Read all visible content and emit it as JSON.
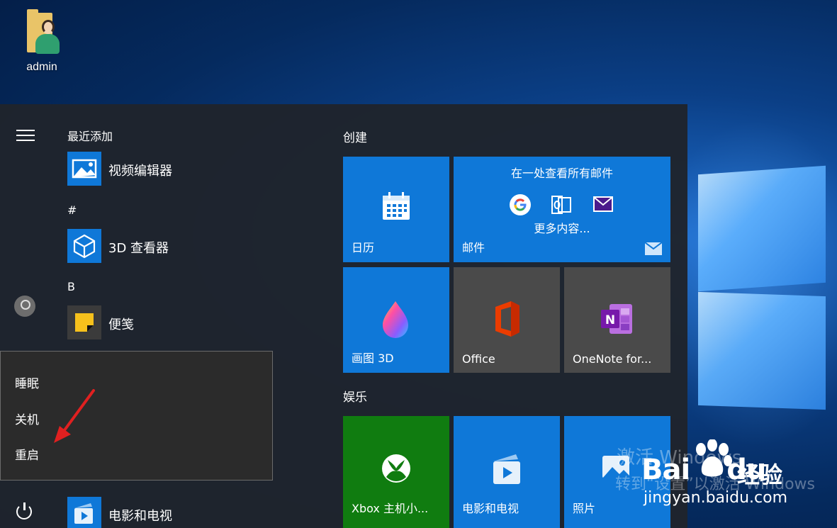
{
  "desktop": {
    "icon_label": "admin"
  },
  "start_menu": {
    "app_list": {
      "recent_header": "最近添加",
      "hash_header": "#",
      "b_header": "B",
      "apps": [
        {
          "name": "视频编辑器",
          "icon": "video-editor-icon"
        },
        {
          "name": "3D 查看器",
          "icon": "3d-viewer-icon"
        },
        {
          "name": "便笺",
          "icon": "sticky-notes-icon"
        },
        {
          "name": "电影和电视",
          "icon": "movies-tv-icon"
        }
      ]
    },
    "tiles": {
      "create_header": "创建",
      "entertainment_header": "娱乐",
      "calendar": "日历",
      "mail": "邮件",
      "mail_promo": "在一处查看所有邮件",
      "mail_more": "更多内容...",
      "paint3d": "画图 3D",
      "office": "Office",
      "onenote": "OneNote for...",
      "xbox": "Xbox 主机小...",
      "movies": "电影和电视",
      "photos": "照片"
    },
    "power_menu": {
      "sleep": "睡眠",
      "shutdown": "关机",
      "restart": "重启"
    }
  },
  "watermark": {
    "activate": "激活 Windows",
    "goto": "转到“设置”以激活 Windows",
    "brand_a": "Bai",
    "brand_b": "du",
    "brand_cn": "经验",
    "url": "jingyan.baidu.com"
  },
  "colors": {
    "tile_blue": "#0f78d8",
    "tile_gray": "#4a4a4a",
    "tile_green": "#107c10",
    "annotation_red": "#e02020"
  }
}
